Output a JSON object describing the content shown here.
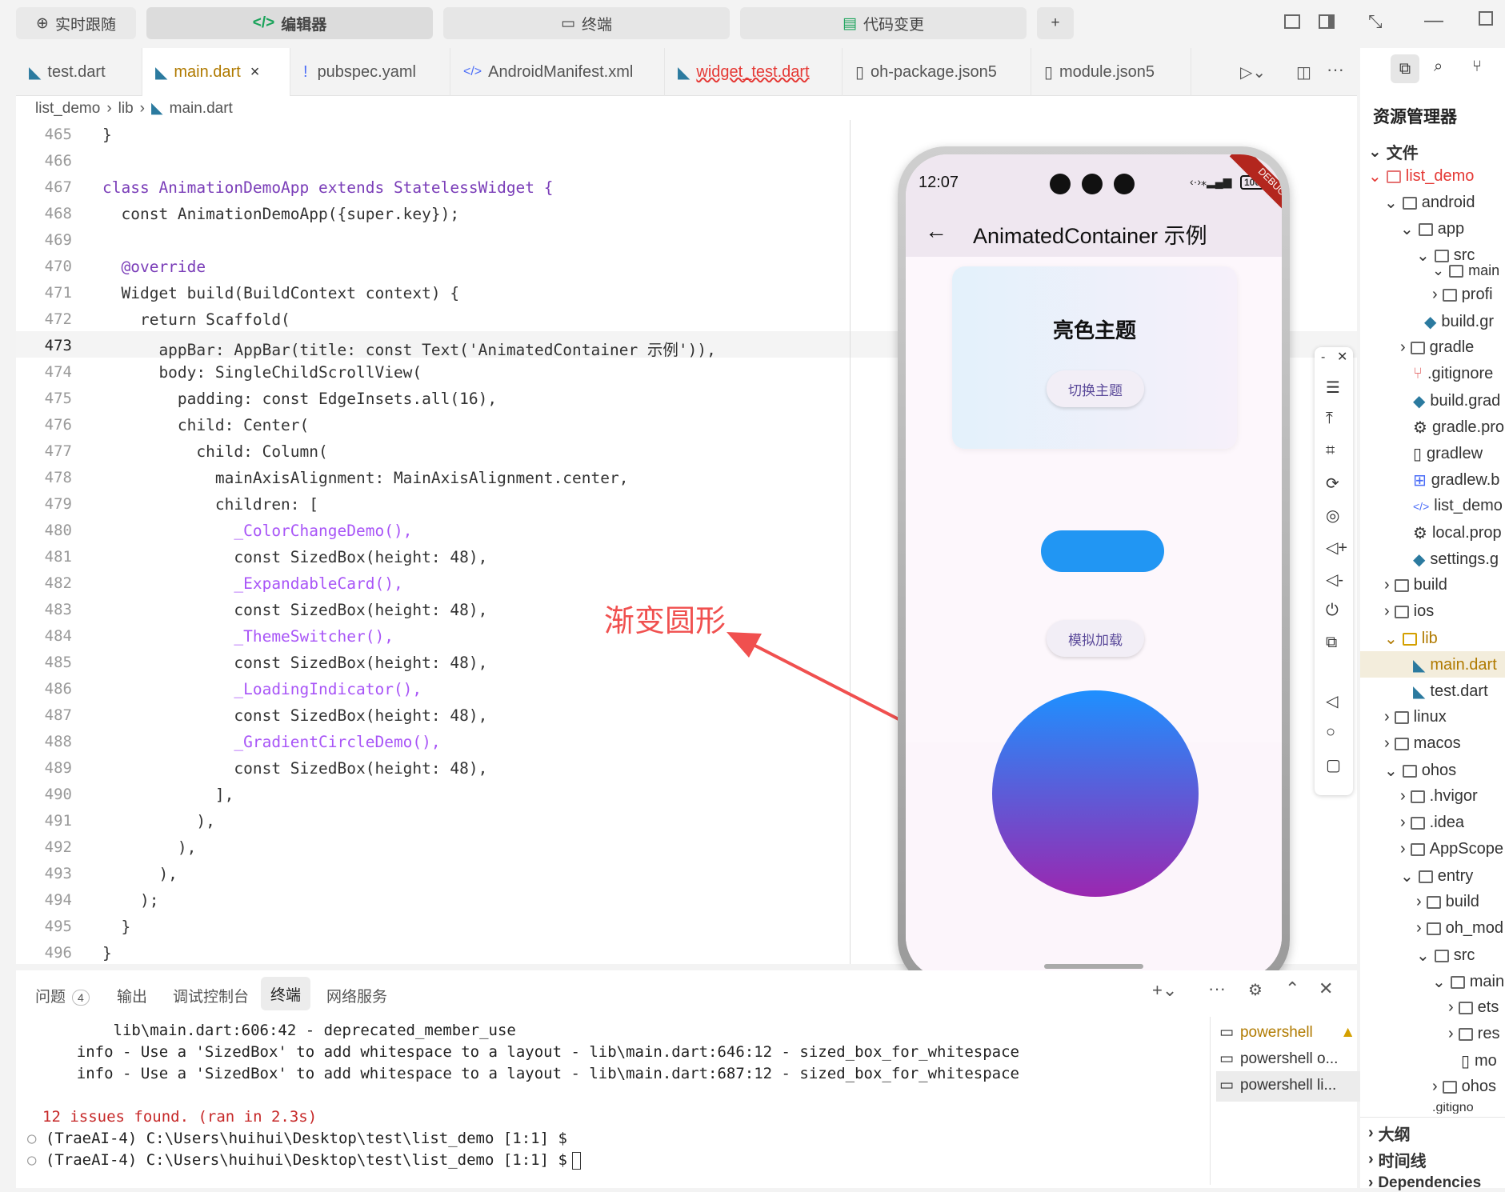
{
  "topbar": {
    "follow": "实时跟随",
    "editor": "编辑器",
    "terminal": "终端",
    "changes": "代码变更",
    "add": "+"
  },
  "tabs": [
    {
      "label": "test.dart"
    },
    {
      "label": "main.dart",
      "close": "×"
    },
    {
      "label": "pubspec.yaml",
      "prefix": "!"
    },
    {
      "label": "AndroidManifest.xml"
    },
    {
      "label": "widget_test.dart"
    },
    {
      "label": "oh-package.json5"
    },
    {
      "label": "module.json5"
    }
  ],
  "breadcrumb": [
    "list_demo",
    "lib",
    "main.dart"
  ],
  "code": {
    "lines": [
      {
        "n": "465",
        "t": "}"
      },
      {
        "n": "466",
        "t": ""
      },
      {
        "n": "467",
        "t": "class AnimationDemoApp extends StatelessWidget {"
      },
      {
        "n": "468",
        "t": "  const AnimationDemoApp({super.key});"
      },
      {
        "n": "469",
        "t": ""
      },
      {
        "n": "470",
        "t": "  @override"
      },
      {
        "n": "471",
        "t": "  Widget build(BuildContext context) {"
      },
      {
        "n": "472",
        "t": "    return Scaffold("
      },
      {
        "n": "473",
        "t": "      appBar: AppBar(title: const Text('AnimatedContainer 示例')),"
      },
      {
        "n": "474",
        "t": "      body: SingleChildScrollView("
      },
      {
        "n": "475",
        "t": "        padding: const EdgeInsets.all(16),"
      },
      {
        "n": "476",
        "t": "        child: Center("
      },
      {
        "n": "477",
        "t": "          child: Column("
      },
      {
        "n": "478",
        "t": "            mainAxisAlignment: MainAxisAlignment.center,"
      },
      {
        "n": "479",
        "t": "            children: ["
      },
      {
        "n": "480",
        "t": "              _ColorChangeDemo(),"
      },
      {
        "n": "481",
        "t": "              const SizedBox(height: 48),"
      },
      {
        "n": "482",
        "t": "              _ExpandableCard(),"
      },
      {
        "n": "483",
        "t": "              const SizedBox(height: 48),"
      },
      {
        "n": "484",
        "t": "              _ThemeSwitcher(),"
      },
      {
        "n": "485",
        "t": "              const SizedBox(height: 48),"
      },
      {
        "n": "486",
        "t": "              _LoadingIndicator(),"
      },
      {
        "n": "487",
        "t": "              const SizedBox(height: 48),"
      },
      {
        "n": "488",
        "t": "              _GradientCircleDemo(),"
      },
      {
        "n": "489",
        "t": "              const SizedBox(height: 48),"
      },
      {
        "n": "490",
        "t": "            ],"
      },
      {
        "n": "491",
        "t": "          ),"
      },
      {
        "n": "492",
        "t": "        ),"
      },
      {
        "n": "493",
        "t": "      ),"
      },
      {
        "n": "494",
        "t": "    );"
      },
      {
        "n": "495",
        "t": "  }"
      },
      {
        "n": "496",
        "t": "}"
      }
    ]
  },
  "annotation": "渐变圆形",
  "phone": {
    "time": "12:07",
    "battery": "100",
    "debug": "DEBUG",
    "title": "AnimatedContainer 示例",
    "card_title": "亮色主题",
    "switch_button": "切换主题",
    "load_button": "模拟加载"
  },
  "panel": {
    "tabs": [
      "问题",
      "输出",
      "调试控制台",
      "终端",
      "网络服务"
    ],
    "problem_count": "4",
    "lines": [
      "        lib\\main.dart:606:42 - deprecated_member_use",
      "    info - Use a 'SizedBox' to add whitespace to a layout - lib\\main.dart:646:12 - sized_box_for_whitespace",
      "    info - Use a 'SizedBox' to add whitespace to a layout - lib\\main.dart:687:12 - sized_box_for_whitespace"
    ],
    "issues": "12 issues found. (ran in 2.3s)",
    "prompts": [
      "(TraeAI-4) C:\\Users\\huihui\\Desktop\\test\\list_demo [1:1] $",
      "(TraeAI-4) C:\\Users\\huihui\\Desktop\\test\\list_demo [1:1] $"
    ],
    "sessions": [
      "powershell",
      "powershell o...",
      "powershell li..."
    ]
  },
  "sidebar": {
    "title": "资源管理器",
    "files": "文件",
    "tree": [
      "list_demo",
      "android",
      "app",
      "src",
      "main",
      "profi",
      "build.gr",
      "gradle",
      ".gitignore",
      "build.grad",
      "gradle.pro",
      "gradlew",
      "gradlew.b",
      "list_demo",
      "local.prop",
      "settings.g",
      "build",
      "ios",
      "lib",
      "main.dart",
      "test.dart",
      "linux",
      "macos",
      "ohos",
      ".hvigor",
      ".idea",
      "AppScope",
      "entry",
      "build",
      "oh_mod",
      "src",
      "main",
      "ets",
      "res",
      "mo",
      "ohos",
      ".gitigno"
    ],
    "outline": "大纲",
    "timeline": "时间线",
    "deps": "Dependencies"
  },
  "colors": {
    "accent": "#b07a00",
    "arrow": "#f0504f",
    "circle_top": "#1e90ff",
    "circle_bottom": "#9b27b0",
    "pill": "#2196f3"
  }
}
